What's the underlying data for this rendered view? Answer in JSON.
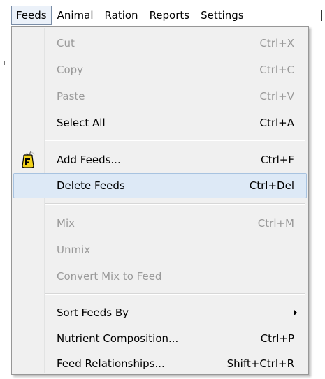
{
  "menubar": {
    "items": [
      {
        "label": "Feeds",
        "active": true
      },
      {
        "label": "Animal"
      },
      {
        "label": "Ration"
      },
      {
        "label": "Reports"
      },
      {
        "label": "Settings"
      }
    ]
  },
  "feeds_menu": {
    "cut": {
      "label": "Cut",
      "shortcut": "Ctrl+X"
    },
    "copy": {
      "label": "Copy",
      "shortcut": "Ctrl+C"
    },
    "paste": {
      "label": "Paste",
      "shortcut": "Ctrl+V"
    },
    "select_all": {
      "label": "Select All",
      "shortcut": "Ctrl+A"
    },
    "add_feeds": {
      "label": "Add Feeds...",
      "shortcut": "Ctrl+F",
      "icon": "feed-bag-icon"
    },
    "delete_feeds": {
      "label": "Delete Feeds",
      "shortcut": "Ctrl+Del"
    },
    "mix": {
      "label": "Mix",
      "shortcut": "Ctrl+M"
    },
    "unmix": {
      "label": "Unmix"
    },
    "convert_mix": {
      "label": "Convert Mix to Feed"
    },
    "sort_feeds": {
      "label": "Sort Feeds By"
    },
    "nutrient_composition": {
      "label": "Nutrient Composition...",
      "shortcut": "Ctrl+P"
    },
    "feed_relationships": {
      "label": "Feed Relationships...",
      "shortcut": "Shift+Ctrl+R"
    }
  },
  "colors": {
    "menu_background": "#f0f0f0",
    "highlight": "#dde9f6",
    "disabled_text": "#9a9a9a"
  }
}
